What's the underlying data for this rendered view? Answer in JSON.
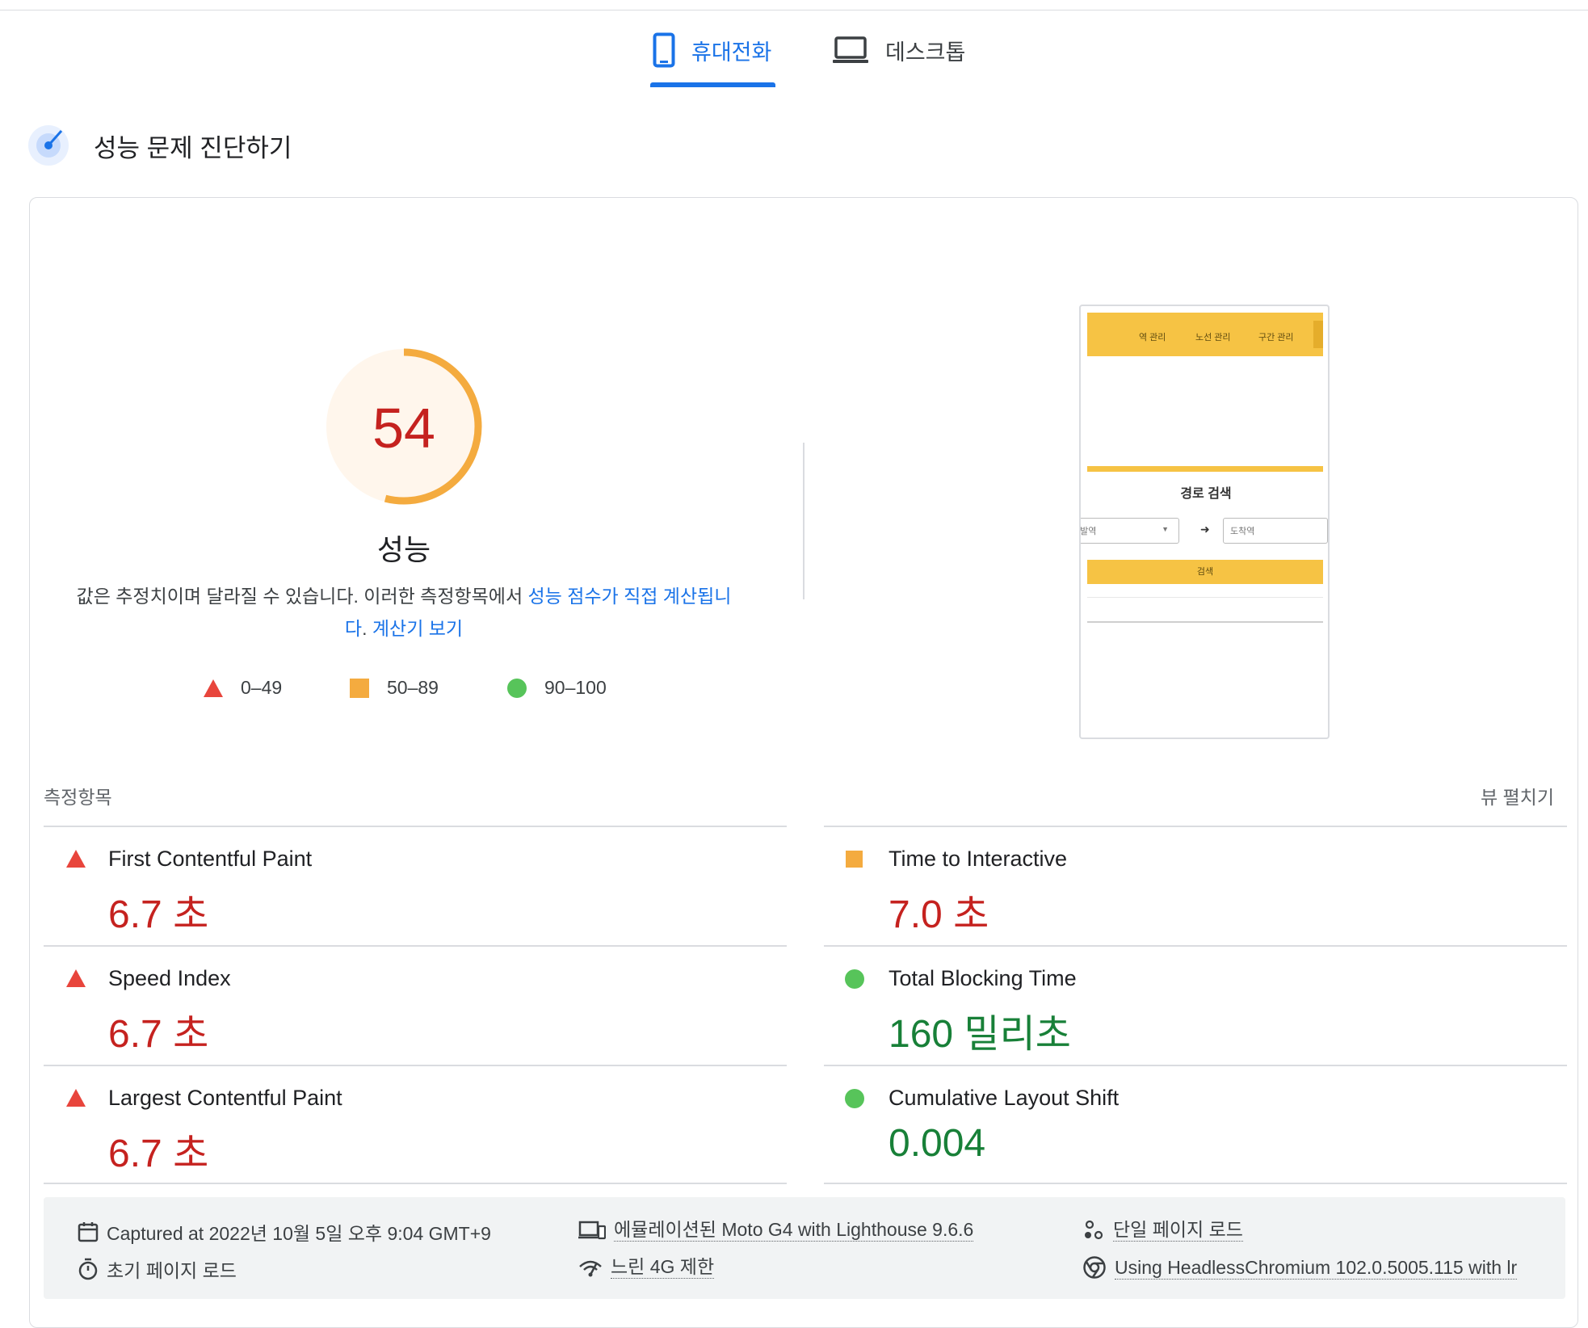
{
  "tabs": {
    "mobile": "휴대전화",
    "desktop": "데스크톱"
  },
  "section_title": "성능 문제 진단하기",
  "score": {
    "value": "54",
    "fraction": 0.54,
    "label": "성능",
    "color": "#c5221f",
    "ring_color": "#f4ab3f"
  },
  "description": {
    "text": "값은 추정치이며 달라질 수 있습니다. 이러한 측정항목에서 ",
    "link1": "성능 점수가 직접 계산됩니다",
    "link2": "계산기 보기"
  },
  "legend": [
    {
      "range": "0–49",
      "shape": "triangle",
      "color": "#e8453c"
    },
    {
      "range": "50–89",
      "shape": "square",
      "color": "#f4ab3f"
    },
    {
      "range": "90–100",
      "shape": "circle",
      "color": "#57c45a"
    }
  ],
  "thumbnail": {
    "nav_items": [
      "역 관리",
      "노선 관리",
      "구간 관리"
    ],
    "title": "경로 검색",
    "departure_placeholder": "출발역",
    "arrival_placeholder": "도착역",
    "search_button": "검색"
  },
  "metrics_header": "측정항목",
  "expand_view": "뷰 펼치기",
  "metrics": [
    {
      "name": "First Contentful Paint",
      "value": "6.7 초",
      "status": "poor"
    },
    {
      "name": "Time to Interactive",
      "value": "7.0 초",
      "status": "average"
    },
    {
      "name": "Speed Index",
      "value": "6.7 초",
      "status": "poor"
    },
    {
      "name": "Total Blocking Time",
      "value": "160 밀리초",
      "status": "good"
    },
    {
      "name": "Largest Contentful Paint",
      "value": "6.7 초",
      "status": "poor"
    },
    {
      "name": "Cumulative Layout Shift",
      "value": "0.004",
      "status": "good"
    }
  ],
  "footer": {
    "captured": "Captured at 2022년 10월 5일 오후 9:04 GMT+9",
    "emulated": "에뮬레이션된 Moto G4 with Lighthouse 9.6.6",
    "single_page": "단일 페이지 로드",
    "initial_load": "초기 페이지 로드",
    "throttling": "느린 4G 제한",
    "browser": "Using HeadlessChromium 102.0.5005.115 with lr"
  }
}
